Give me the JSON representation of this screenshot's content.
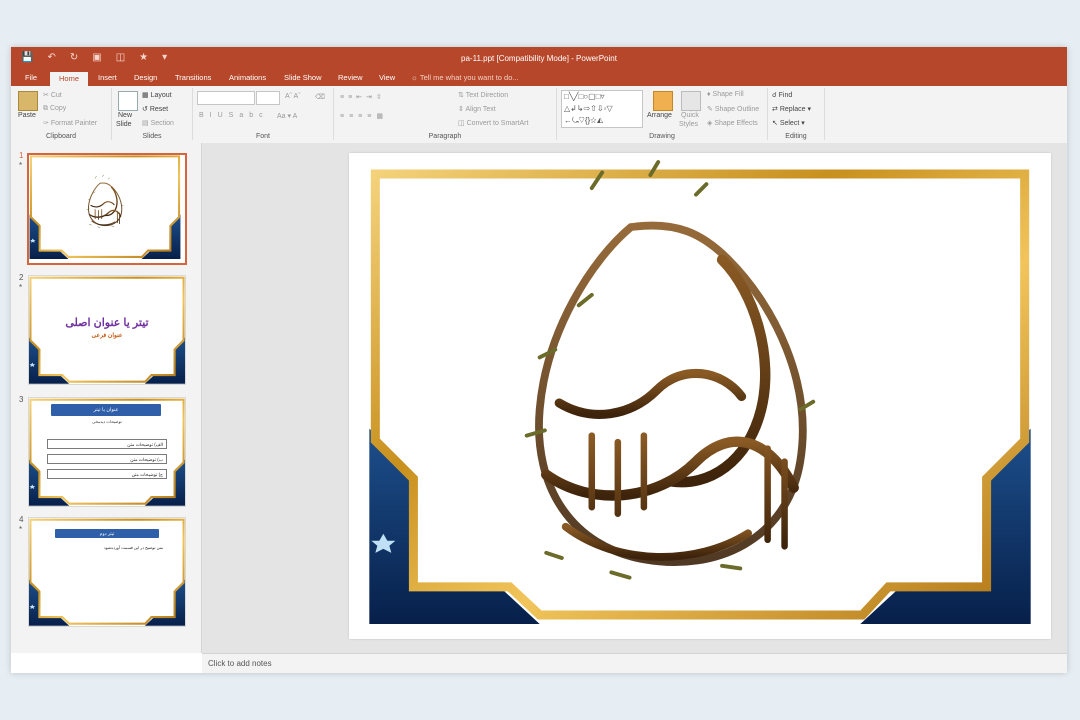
{
  "window": {
    "title": "pa-11.ppt [Compatibility Mode] - PowerPoint"
  },
  "qat": {
    "icons": [
      "save-icon",
      "undo-icon",
      "redo-icon",
      "present-icon",
      "layout-icon",
      "star-icon",
      "customize-icon"
    ]
  },
  "tabs": [
    "File",
    "Home",
    "Insert",
    "Design",
    "Transitions",
    "Animations",
    "Slide Show",
    "Review",
    "View"
  ],
  "tell_me": "Tell me what you want to do...",
  "ribbon": {
    "clipboard": {
      "label": "Clipboard",
      "paste": "Paste",
      "cut": "Cut",
      "copy": "Copy",
      "format_painter": "Format Painter"
    },
    "slides": {
      "label": "Slides",
      "new_slide_1": "New",
      "new_slide_2": "Slide",
      "layout": "Layout",
      "reset": "Reset",
      "section": "Section"
    },
    "font": {
      "label": "Font"
    },
    "paragraph": {
      "label": "Paragraph",
      "text_direction": "Text Direction",
      "align_text": "Align Text",
      "convert_smartart": "Convert to SmartArt"
    },
    "drawing": {
      "label": "Drawing",
      "arrange": "Arrange",
      "quick_styles_1": "Quick",
      "quick_styles_2": "Styles",
      "shape_fill": "Shape Fill",
      "shape_outline": "Shape Outline",
      "shape_effects": "Shape Effects"
    },
    "editing": {
      "label": "Editing",
      "find": "Find",
      "replace": "Replace",
      "select": "Select"
    }
  },
  "thumbnails": [
    {
      "number": "1",
      "star": "*"
    },
    {
      "number": "2",
      "star": "*",
      "title": "تیتر یا عنوان اصلی",
      "subtitle": "عنوان فرعی"
    },
    {
      "number": "3",
      "star": "",
      "header": "عنوان یا تیتر",
      "caption": "توضیحات دیدمخی",
      "items": [
        "الف) توضیحات متن",
        "ب) توضیحات متن",
        "ج) توضیحات متن"
      ]
    },
    {
      "number": "4",
      "star": "*",
      "header": "تیتر دوم",
      "body": "متن توضیح در این قسمت آورده‌شود"
    }
  ],
  "notes": {
    "placeholder": "Click to add notes"
  },
  "colors": {
    "accent": "#b7472a",
    "gold": "#d9a52e",
    "navy": "#0e2c5a",
    "calligraphy": "#5a3512"
  }
}
